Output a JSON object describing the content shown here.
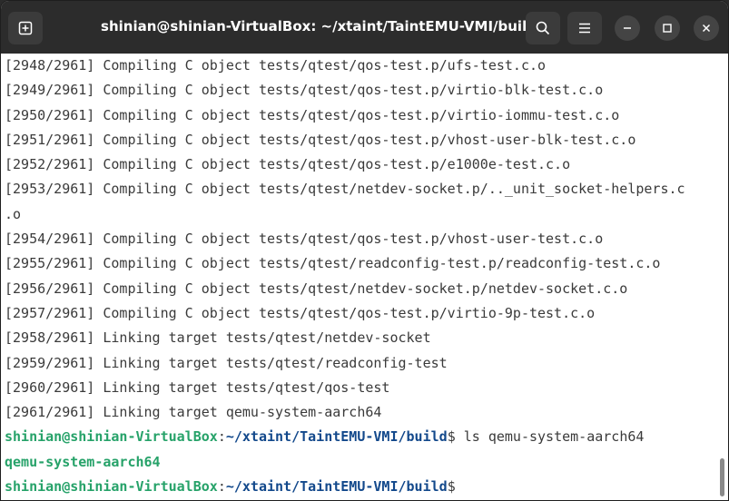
{
  "window": {
    "title": "shinian@shinian-VirtualBox: ~/xtaint/TaintEMU-VMI/build"
  },
  "titlebar": {
    "new_tab_icon": "new-tab-icon",
    "search_icon": "search-icon",
    "menu_icon": "hamburger-menu-icon",
    "minimize_icon": "minimize-icon",
    "maximize_icon": "maximize-icon",
    "close_icon": "close-icon"
  },
  "terminal": {
    "output_lines": [
      "[2948/2961] Compiling C object tests/qtest/qos-test.p/ufs-test.c.o",
      "[2949/2961] Compiling C object tests/qtest/qos-test.p/virtio-blk-test.c.o",
      "[2950/2961] Compiling C object tests/qtest/qos-test.p/virtio-iommu-test.c.o",
      "[2951/2961] Compiling C object tests/qtest/qos-test.p/vhost-user-blk-test.c.o",
      "[2952/2961] Compiling C object tests/qtest/qos-test.p/e1000e-test.c.o",
      "[2953/2961] Compiling C object tests/qtest/netdev-socket.p/.._unit_socket-helpers.c",
      ".o",
      "[2954/2961] Compiling C object tests/qtest/qos-test.p/vhost-user-test.c.o",
      "[2955/2961] Compiling C object tests/qtest/readconfig-test.p/readconfig-test.c.o",
      "[2956/2961] Compiling C object tests/qtest/netdev-socket.p/netdev-socket.c.o",
      "[2957/2961] Compiling C object tests/qtest/qos-test.p/virtio-9p-test.c.o",
      "[2958/2961] Linking target tests/qtest/netdev-socket",
      "[2959/2961] Linking target tests/qtest/readconfig-test",
      "[2960/2961] Linking target tests/qtest/qos-test",
      "[2961/2961] Linking target qemu-system-aarch64"
    ],
    "prompt1": {
      "user": "shinian@shinian-VirtualBox",
      "sep": ":",
      "path": "~/xtaint/TaintEMU-VMI/build",
      "symbol": "$",
      "command": " ls qemu-system-aarch64"
    },
    "ls_output": "qemu-system-aarch64",
    "prompt2": {
      "user": "shinian@shinian-VirtualBox",
      "sep": ":",
      "path": "~/xtaint/TaintEMU-VMI/build",
      "symbol": "$"
    }
  },
  "colors": {
    "prompt_user": "#26a269",
    "prompt_path": "#12488b",
    "titlebar_bg": "#2c2c2c",
    "terminal_bg": "#ffffff",
    "text": "#3a3a3a"
  }
}
